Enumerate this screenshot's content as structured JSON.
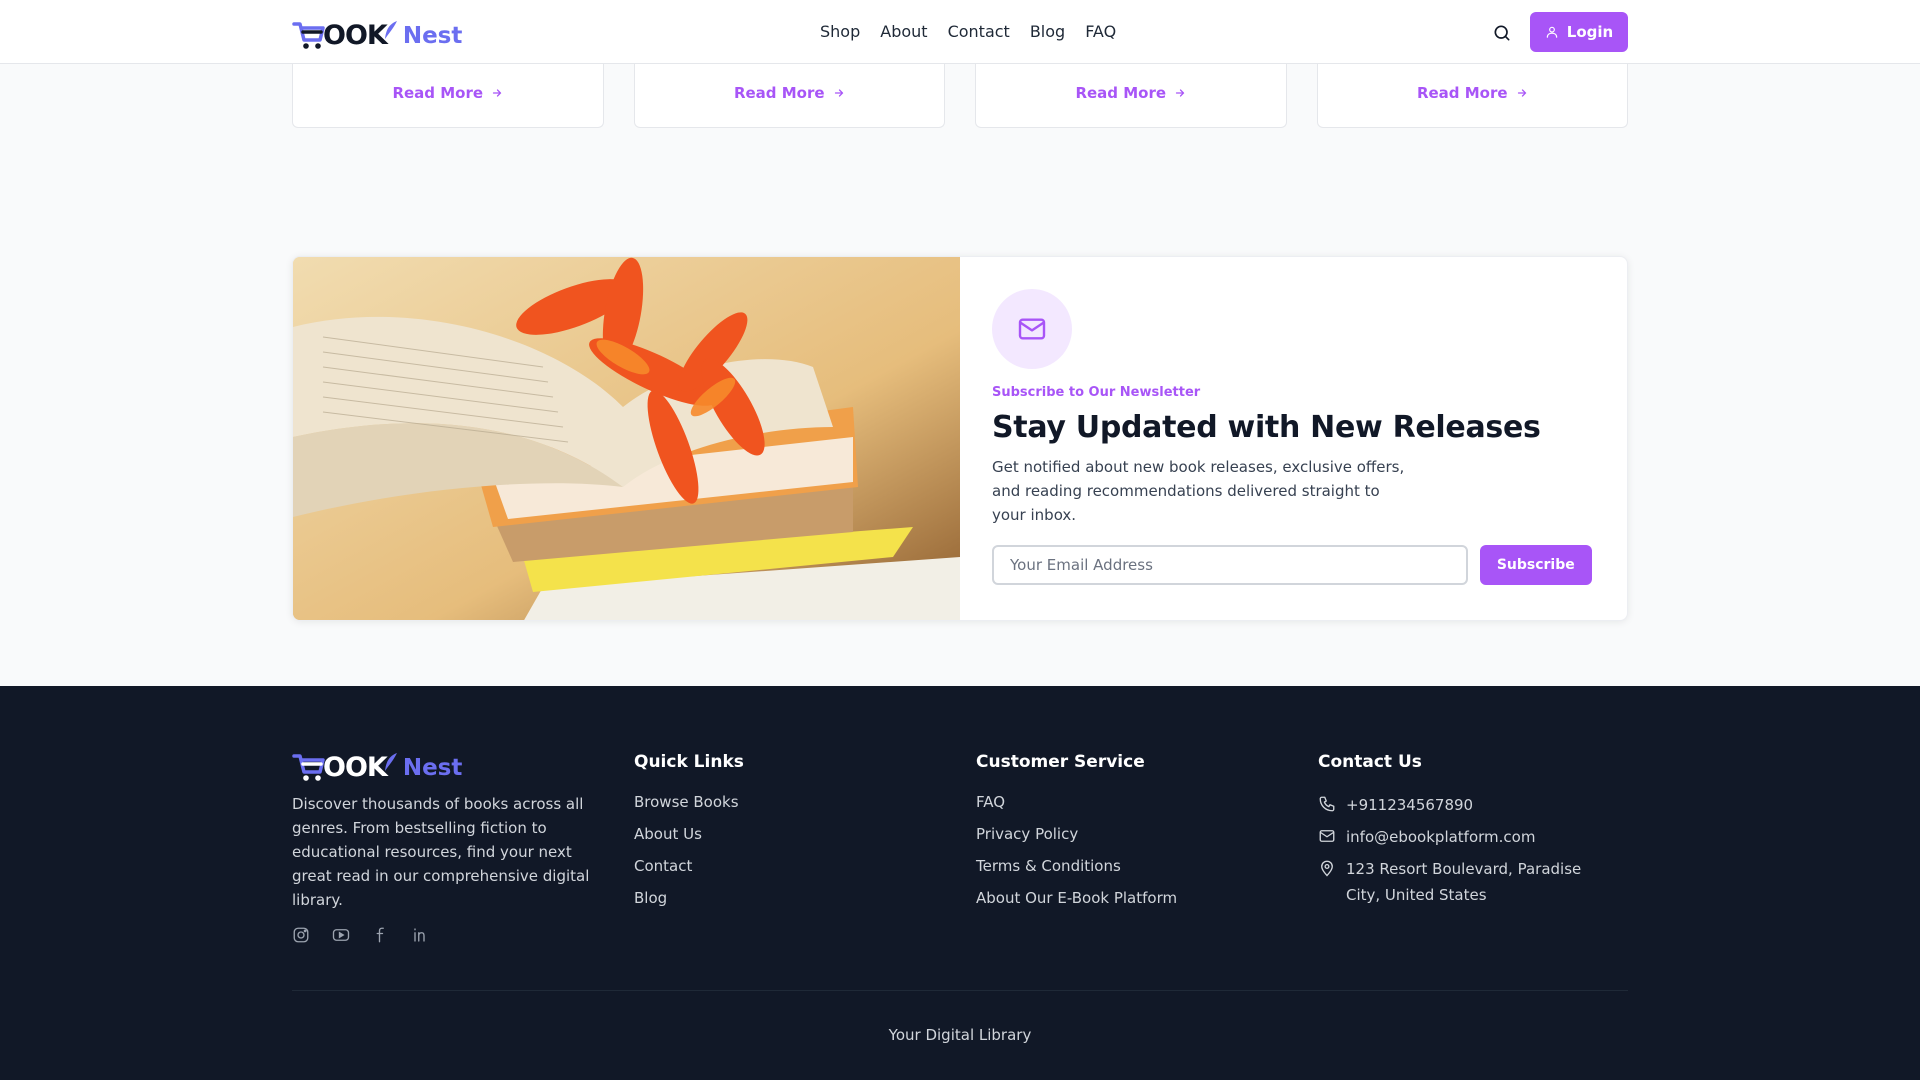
{
  "brand": {
    "logo_main": "OOK",
    "logo_accent": "Nest"
  },
  "nav": {
    "items": [
      "Shop",
      "About",
      "Contact",
      "Blog",
      "FAQ"
    ],
    "login_label": "Login"
  },
  "blog_cards": {
    "read_more_label": "Read More"
  },
  "newsletter": {
    "eyebrow": "Subscribe to Our Newsletter",
    "title": "Stay Updated with New Releases",
    "description": "Get notified about new book releases, exclusive offers, and reading recommendations delivered straight to your inbox.",
    "email_placeholder": "Your Email Address",
    "subscribe_label": "Subscribe"
  },
  "footer": {
    "about": "Discover thousands of books across all genres. From bestselling fiction to educational resources, find your next great read in our comprehensive digital library.",
    "quick_links": {
      "title": "Quick Links",
      "items": [
        "Browse Books",
        "About Us",
        "Contact",
        "Blog"
      ]
    },
    "customer_service": {
      "title": "Customer Service",
      "items": [
        "FAQ",
        "Privacy Policy",
        "Terms & Conditions",
        "About Our E-Book Platform"
      ]
    },
    "contact": {
      "title": "Contact Us",
      "phone": "+911234567890",
      "email": "info@ebookplatform.com",
      "address": "123 Resort Boulevard, Paradise City, United States"
    },
    "tagline": "Your Digital Library"
  },
  "colors": {
    "accent": "#a855f7",
    "logo_accent": "#6b6ef0",
    "footer_bg": "#111827"
  }
}
